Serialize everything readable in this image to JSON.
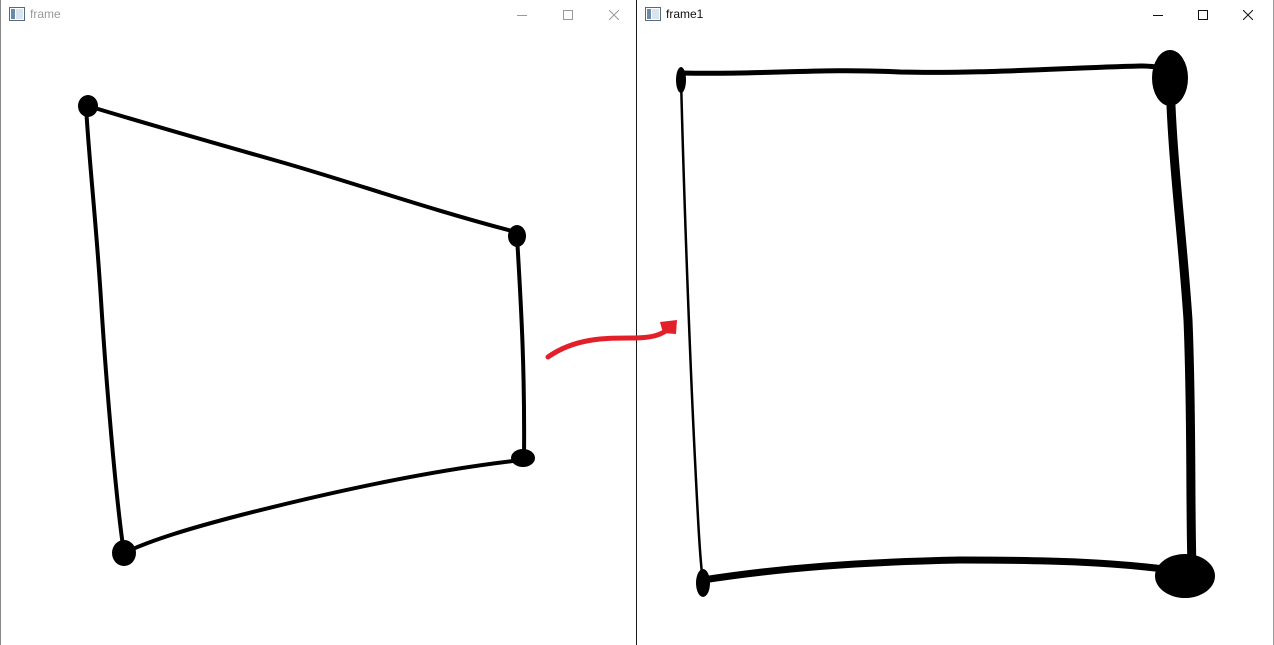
{
  "windows": [
    {
      "title": "frame"
    },
    {
      "title": "frame1"
    }
  ],
  "icons": {
    "app": "window-app-icon",
    "minimize": "minimize-icon",
    "maximize": "maximize-icon",
    "close": "close-icon"
  },
  "colors": {
    "stroke": "#000000",
    "arrow": "#e3202a"
  }
}
